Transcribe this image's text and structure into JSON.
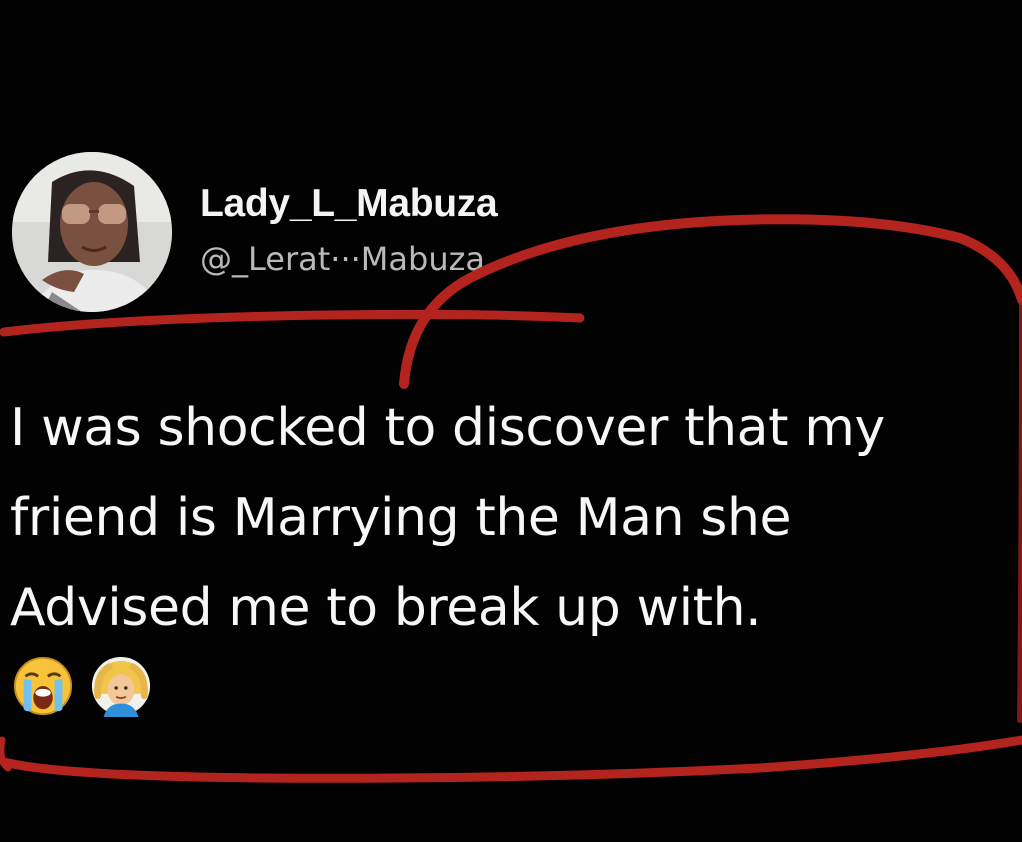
{
  "tweet": {
    "display_name": "Lady_L_Mabuza",
    "handle": "@_Lerat···Mabuza",
    "text_lines": [
      "I was shocked to discover that my",
      "friend is Marrying the Man she",
      "Advised me to break up with."
    ],
    "emojis": [
      "loudly-crying-face-icon",
      "person-gesturing-ok-icon"
    ]
  },
  "colors": {
    "background": "#020202",
    "annotation": "#b3241f",
    "text": "#f7f7f7",
    "handle": "#b9b9b9"
  }
}
